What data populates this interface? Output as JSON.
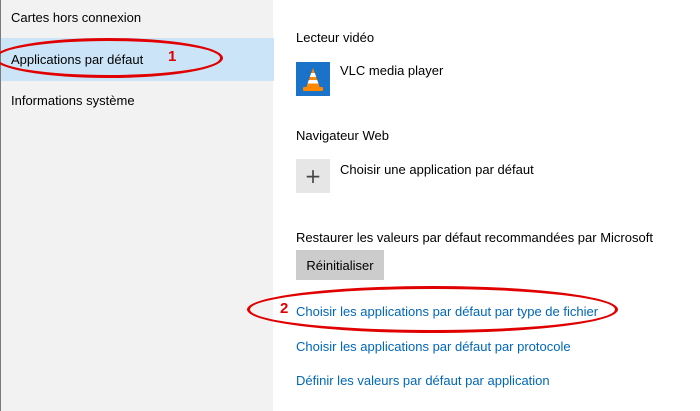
{
  "sidebar": {
    "items": [
      {
        "label": "Cartes hors connexion"
      },
      {
        "label": "Applications par défaut"
      },
      {
        "label": "Informations système"
      }
    ]
  },
  "annotations": {
    "marker_1": "1",
    "marker_2": "2",
    "color": "#e00000"
  },
  "main": {
    "video_player": {
      "label": "Lecteur vidéo",
      "app_name": "VLC media player",
      "icon": "vlc-cone-icon"
    },
    "web_browser": {
      "label": "Navigateur Web",
      "app_name": "Choisir une application par défaut",
      "icon": "plus-icon"
    },
    "reset": {
      "label": "Restaurer les valeurs par défaut recommandées par Microsoft",
      "button_label": "Réinitialiser"
    },
    "links": [
      {
        "label": "Choisir les applications par défaut par type de fichier"
      },
      {
        "label": "Choisir les applications par défaut par protocole"
      },
      {
        "label": "Définir les valeurs par défaut par application"
      }
    ]
  },
  "colors": {
    "sidebar_bg": "#f2f2f2",
    "selected_bg": "#cce4f7",
    "link": "#0067b8",
    "button_bg": "#cccccc"
  }
}
